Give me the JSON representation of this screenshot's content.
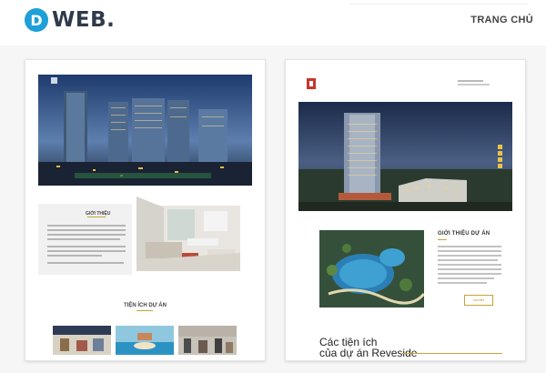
{
  "header": {
    "logo_letter": "D",
    "logo_text": "WEB.",
    "nav_home": "TRANG CHỦ"
  },
  "colors": {
    "brand_blue": "#1d9fd8",
    "gold": "#c9a13b",
    "dark_text": "#2f3b4c"
  },
  "projects": [
    {
      "about_title": "GIỚI THIỆU",
      "amenities_title": "TIỆN ÍCH DỰ ÁN"
    },
    {
      "intro_title": "GIỚI THIỆU DỰ ÁN",
      "button_label": "CHI TIẾT",
      "heading_line1": "Các tiện ích",
      "heading_line2": "của dự án Reveside"
    }
  ]
}
